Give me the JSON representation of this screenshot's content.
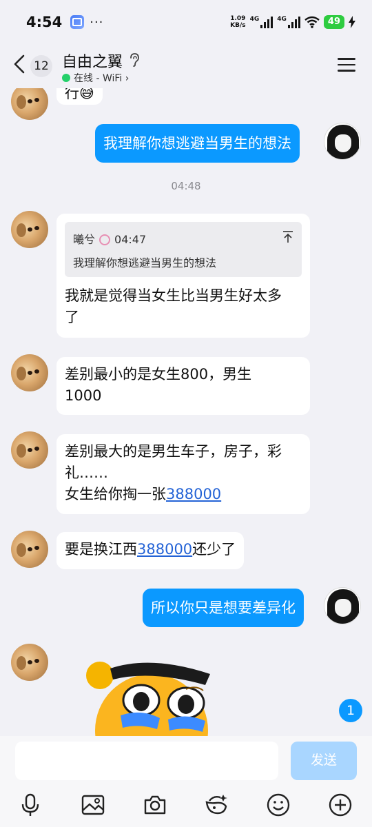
{
  "status_bar": {
    "time": "4:54",
    "more": "···",
    "net_speed_value": "1.09",
    "net_speed_unit": "KB/s",
    "network_1": "4G",
    "network_2": "4G",
    "battery": "49"
  },
  "header": {
    "unread_count": "12",
    "contact_name": "自由之翼",
    "online_status": "在线 - WiFi",
    "online_chevron": "›"
  },
  "messages": [
    {
      "side": "left",
      "text_fragment": "行😅"
    },
    {
      "side": "right",
      "text": "我理解你想逃避当男生的想法"
    },
    {
      "timestamp": "04:48"
    },
    {
      "side": "left",
      "quote_sender": "曦兮",
      "quote_time": "04:47",
      "quote_text": "我理解你想逃避当男生的想法",
      "text_line1": "我就是觉得当女生比当男生好太多",
      "text_line2": "了"
    },
    {
      "side": "left",
      "text_line1": "差别最小的是女生800，男生",
      "text_line2": "1000"
    },
    {
      "side": "left",
      "text_line1": "差别最大的是男生车子，房子，彩",
      "text_line2": "礼……",
      "text_line3_prefix": "女生给你掏一张",
      "text_line3_link": "388000"
    },
    {
      "side": "left",
      "text_prefix": "要是换江西",
      "text_link": "388000",
      "text_suffix": "还少了"
    },
    {
      "side": "right",
      "text": "所以你只是想要差异化"
    },
    {
      "side": "left",
      "sticker": "crying-emoji-with-sunglasses"
    }
  ],
  "unread_badge": "1",
  "input": {
    "placeholder": "",
    "send_label": "发送"
  },
  "toolbar_icons": [
    "microphone-icon",
    "image-icon",
    "camera-icon",
    "red-packet-icon",
    "emoji-icon",
    "plus-icon"
  ],
  "colors": {
    "self_bubble": "#0b99ff",
    "background": "#f1f1f6",
    "online": "#25d06a",
    "battery": "#2ecc40",
    "send_disabled": "#a9d6ff"
  }
}
